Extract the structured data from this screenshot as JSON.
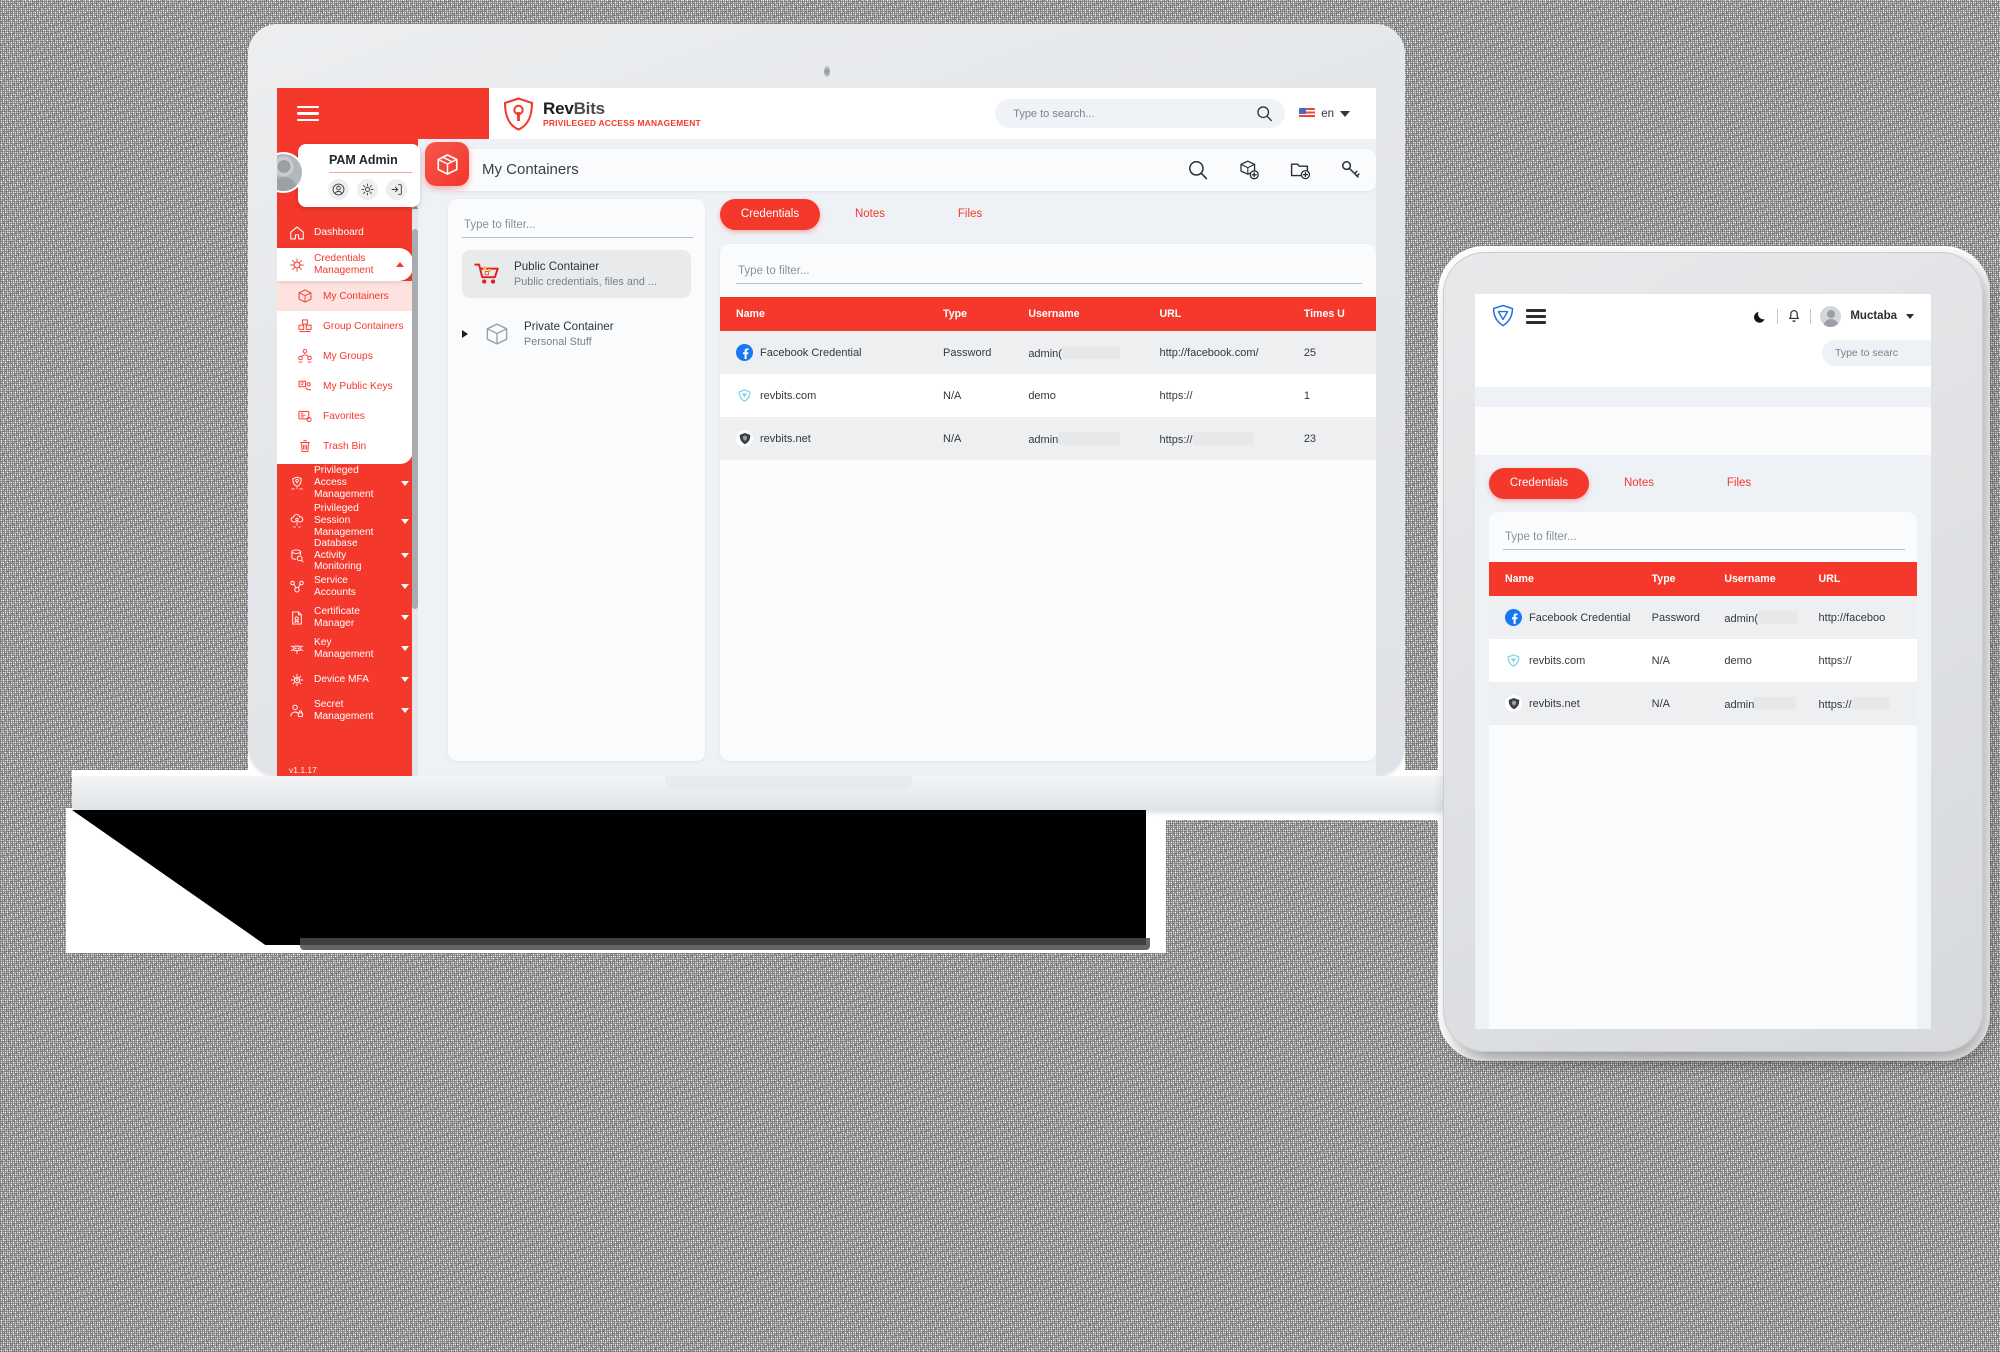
{
  "topbar": {
    "menu_icon": "hamburger-icon",
    "brand_name_rev": "Rev",
    "brand_name_bits": "Bits",
    "brand_tagline": "PRIVILEGED ACCESS MANAGEMENT",
    "search_placeholder": "Type to search...",
    "search_value": "",
    "search_icon": "search-icon",
    "language_code": "en",
    "flag_icon": "us-flag-icon",
    "chevron_icon": "chevron-down-icon"
  },
  "profile": {
    "name": "PAM Admin",
    "avatar_icon": "user-avatar-icon",
    "actions": [
      {
        "name": "account-button",
        "icon": "user-circle-icon"
      },
      {
        "name": "settings-button",
        "icon": "gear-icon"
      },
      {
        "name": "logout-button",
        "icon": "logout-icon"
      }
    ]
  },
  "sidebar": {
    "version": "v1.1.17",
    "items": [
      {
        "label": "Dashboard",
        "icon": "home-icon",
        "state": "plain"
      },
      {
        "label": "Credentials Management",
        "icon": "bug-network-icon",
        "state": "open-group"
      },
      {
        "label": "Privileged Access Management",
        "icon": "shield-cloud-icon",
        "state": "collapsed-group"
      },
      {
        "label": "Privileged Session Management",
        "icon": "session-cloud-icon",
        "state": "collapsed-group"
      },
      {
        "label": "Database Activity Monitoring",
        "icon": "database-search-icon",
        "state": "collapsed-group"
      },
      {
        "label": "Service Accounts",
        "icon": "service-nodes-icon",
        "state": "collapsed-group"
      },
      {
        "label": "Certificate Manager",
        "icon": "certificate-icon",
        "state": "collapsed-group"
      },
      {
        "label": "Key Management",
        "icon": "key-network-icon",
        "state": "collapsed-group"
      },
      {
        "label": "Device MFA",
        "icon": "device-mfa-icon",
        "state": "collapsed-group"
      },
      {
        "label": "Secret Management",
        "icon": "user-lock-icon",
        "state": "collapsed-group"
      }
    ],
    "submenu": [
      {
        "label": "My Containers",
        "icon": "box-icon",
        "active": true
      },
      {
        "label": "Group Containers",
        "icon": "boxes-icon",
        "active": false
      },
      {
        "label": "My Groups",
        "icon": "group-icon",
        "active": false
      },
      {
        "label": "My Public Keys",
        "icon": "public-key-icon",
        "active": false
      },
      {
        "label": "Favorites",
        "icon": "favorites-icon",
        "active": false
      },
      {
        "label": "Trash Bin",
        "icon": "trash-icon",
        "active": false
      }
    ]
  },
  "page": {
    "title": "My Containers",
    "icon": "box-package-icon",
    "actions": [
      {
        "name": "search-button",
        "icon": "search-icon"
      },
      {
        "name": "add-container-button",
        "icon": "box-plus-icon"
      },
      {
        "name": "add-folder-button",
        "icon": "folder-plus-icon"
      },
      {
        "name": "add-key-button",
        "icon": "key-plus-icon"
      }
    ]
  },
  "containers_panel": {
    "filter_placeholder": "Type to filter...",
    "filter_value": "",
    "items": [
      {
        "name": "Public Container",
        "desc": "Public credentials, files and ...",
        "icon": "shopping-cart-icon",
        "selected": true,
        "expandable": false
      },
      {
        "name": "Private Container",
        "desc": "Personal Stuff",
        "icon": "box-outline-icon",
        "selected": false,
        "expandable": true
      }
    ]
  },
  "tabs": [
    {
      "label": "Credentials",
      "active": true
    },
    {
      "label": "Notes",
      "active": false
    },
    {
      "label": "Files",
      "active": false
    }
  ],
  "table": {
    "filter_placeholder": "Type to filter...",
    "filter_value": "",
    "columns": [
      "Name",
      "Type",
      "Username",
      "URL",
      "Times U"
    ],
    "rows": [
      {
        "name": "Facebook Credential",
        "favicon": "facebook-icon",
        "type": "Password",
        "username": "admin(",
        "url": "http://facebook.com/",
        "times_used": "25"
      },
      {
        "name": "revbits.com",
        "favicon": "revbits-icon",
        "type": "N/A",
        "username": "demo",
        "url": "https://",
        "times_used": "1"
      },
      {
        "name": "revbits.net",
        "favicon": "revbits-shield-icon",
        "type": "N/A",
        "username": "admin",
        "url": "https://",
        "times_used": "23"
      }
    ]
  },
  "tablet": {
    "logo_icon": "revbits-shield-icon",
    "menu_icon": "hamburger-icon",
    "theme_icon": "moon-icon",
    "notification_icon": "bell-icon",
    "avatar_icon": "user-avatar-icon",
    "user_name": "Muctaba",
    "chevron_icon": "chevron-down-icon",
    "search_placeholder": "Type to searc",
    "tabs": [
      {
        "label": "Credentials",
        "active": true
      },
      {
        "label": "Notes",
        "active": false
      },
      {
        "label": "Files",
        "active": false
      }
    ],
    "filter_placeholder": "Type to filter...",
    "columns": [
      "Name",
      "Type",
      "Username",
      "URL"
    ],
    "rows": [
      {
        "name": "Facebook Credential",
        "favicon": "facebook-icon",
        "type": "Password",
        "username": "admin(",
        "url": "http://faceboo"
      },
      {
        "name": "revbits.com",
        "favicon": "revbits-icon",
        "type": "N/A",
        "username": "demo",
        "url": "https://"
      },
      {
        "name": "revbits.net",
        "favicon": "revbits-shield-icon",
        "type": "N/A",
        "username": "admin",
        "url": "https://"
      }
    ]
  },
  "colors": {
    "brand_red": "#F5382C",
    "panel_bg": "#EEF1F6",
    "card_bg": "#FAFBFC",
    "text_dark": "#2F343A"
  }
}
